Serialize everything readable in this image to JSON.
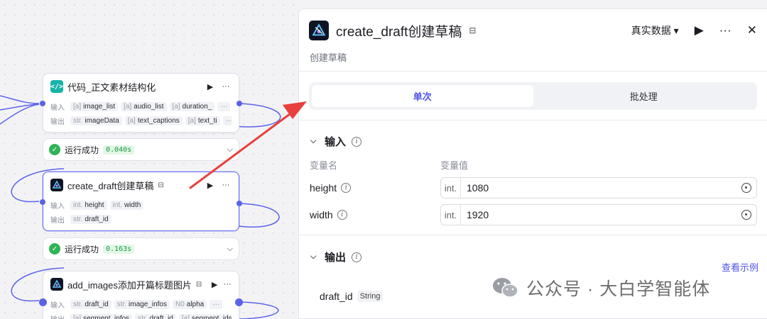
{
  "canvas": {
    "nodes": [
      {
        "title": "代码_正文素材结构化",
        "input_label": "输入",
        "output_label": "输出",
        "inputs": [
          {
            "type": "[a]",
            "name": "image_list"
          },
          {
            "type": "[a]",
            "name": "audio_list"
          },
          {
            "type": "[a]",
            "name": "duration_"
          }
        ],
        "input_more": "···",
        "outputs": [
          {
            "type": "str.",
            "name": "imageData"
          },
          {
            "type": "[a]",
            "name": "text_captions"
          },
          {
            "type": "[a]",
            "name": "text_ti"
          }
        ],
        "output_more": "···"
      },
      {
        "title": "create_draft创建草稿",
        "input_label": "输入",
        "output_label": "输出",
        "inputs": [
          {
            "type": "int.",
            "name": "height"
          },
          {
            "type": "int.",
            "name": "width"
          }
        ],
        "outputs": [
          {
            "type": "str.",
            "name": "draft_id"
          }
        ]
      },
      {
        "title": "add_images添加开篇标题图片",
        "input_label": "输入",
        "output_label": "输出",
        "inputs": [
          {
            "type": "str.",
            "name": "draft_id"
          },
          {
            "type": "str.",
            "name": "image_infos"
          },
          {
            "type": "N0",
            "name": "alpha"
          }
        ],
        "input_more": "···",
        "outputs": [
          {
            "type": "[a]",
            "name": "segment_infos"
          },
          {
            "type": "str.",
            "name": "draft_id"
          },
          {
            "type": "[a]",
            "name": "segment_ids"
          }
        ]
      }
    ],
    "statuses": [
      {
        "text": "运行成功",
        "duration": "0.040s"
      },
      {
        "text": "运行成功",
        "duration": "0.163s"
      }
    ]
  },
  "panel": {
    "title": "create_draft创建草稿",
    "subtitle": "创建草稿",
    "data_mode": "真实数据",
    "tabs": [
      {
        "label": "单次",
        "active": true
      },
      {
        "label": "批处理",
        "active": false
      }
    ],
    "input_section": {
      "title": "输入",
      "col_name": "变量名",
      "col_value": "变量值",
      "variables": [
        {
          "name": "height",
          "type": "int.",
          "value": "1080"
        },
        {
          "name": "width",
          "type": "int.",
          "value": "1920"
        }
      ]
    },
    "output_section": {
      "title": "输出",
      "example_link": "查看示例",
      "fields": [
        {
          "name": "draft_id",
          "type": "String"
        }
      ]
    }
  },
  "watermark": "公众号 · 大白学智能体",
  "colors": {
    "accent": "#4d53e8",
    "success": "#2fb457",
    "arrow": "#e8403c"
  }
}
